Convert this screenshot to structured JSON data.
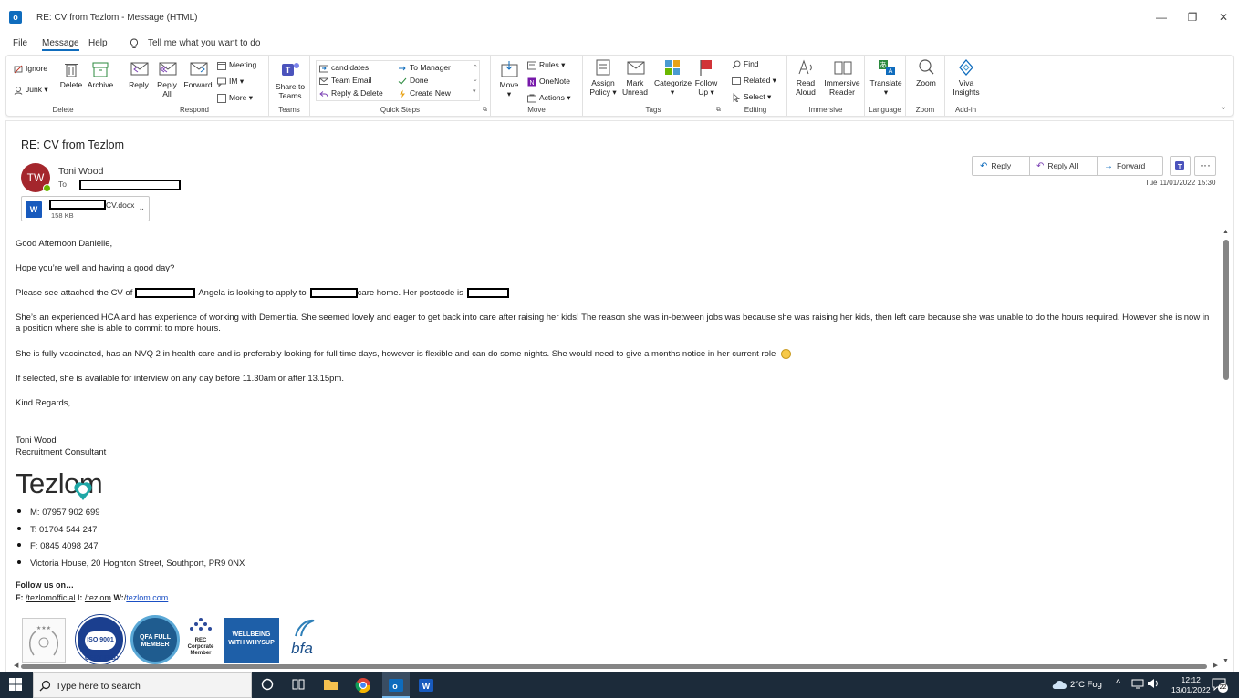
{
  "window": {
    "title": "RE: CV from Tezlom  -  Message (HTML)",
    "minimize": "—",
    "restore": "❐",
    "close": "✕"
  },
  "menu": {
    "tabs": [
      "File",
      "Message",
      "Help"
    ],
    "tell_me": "Tell me what you want to do"
  },
  "ribbon": {
    "delete_group": {
      "label": "Delete",
      "ignore": "Ignore",
      "junk": "Junk",
      "delete": "Delete",
      "archive": "Archive"
    },
    "respond_group": {
      "label": "Respond",
      "reply": "Reply",
      "reply_all": "Reply All",
      "forward": "Forward",
      "meeting": "Meeting",
      "im": "IM",
      "more": "More"
    },
    "teams_group": {
      "label": "Teams",
      "share": "Share to Teams"
    },
    "quicksteps_group": {
      "label": "Quick Steps",
      "candidates": "candidates",
      "team_email": "Team Email",
      "reply_delete": "Reply & Delete",
      "to_manager": "To Manager",
      "done": "Done",
      "create_new": "Create New"
    },
    "move_group": {
      "label": "Move",
      "move": "Move",
      "rules": "Rules",
      "onenote": "OneNote",
      "actions": "Actions"
    },
    "tags_group": {
      "label": "Tags",
      "assign_policy": "Assign Policy",
      "mark_unread": "Mark Unread",
      "categorize": "Categorize",
      "follow_up": "Follow Up"
    },
    "editing_group": {
      "label": "Editing",
      "find": "Find",
      "related": "Related",
      "select": "Select"
    },
    "immersive_group": {
      "label": "Immersive",
      "read_aloud": "Read Aloud",
      "immersive_reader": "Immersive Reader"
    },
    "language_group": {
      "label": "Language",
      "translate": "Translate"
    },
    "zoom_group": {
      "label": "Zoom",
      "zoom": "Zoom"
    },
    "addin_group": {
      "label": "Add-in",
      "viva": "Viva Insights"
    }
  },
  "message": {
    "subject": "RE: CV from Tezlom",
    "avatar_initials": "TW",
    "sender": "Toni Wood",
    "to_label": "To",
    "attachment_name": "CV.docx",
    "attachment_size": "158 KB",
    "attachment_icon": "W",
    "reply": "Reply",
    "reply_all": "Reply All",
    "forward": "Forward",
    "more": "···",
    "datetime": "Tue 11/01/2022 15:30"
  },
  "body": {
    "greeting": "Good Afternoon Danielle,",
    "line1": "Hope you’re well and having a good day?",
    "line2_a": "Please see attached the CV of",
    "line2_b": "Angela is looking to apply to",
    "line2_c": "care home. Her postcode is",
    "para1": "She’s an experienced HCA and has experience of working with Dementia. She seemed lovely and eager to get back into care after raising her kids! The reason she was in-between jobs was because she was raising her kids, then left care because she was unable to do the hours required. However she is now in a position where she is able to commit to more hours.",
    "para2": "She is fully vaccinated, has an NVQ 2 in health care and is preferably looking for full time days, however is flexible and can do some nights. She would need to give a months notice in her current role",
    "para3": "If selected, she is available for interview on any day before 11.30am or after 13.15pm.",
    "closing": "Kind Regards,",
    "sig_name": "Toni Wood",
    "sig_title": "Recruitment Consultant",
    "logo_text": "Tezlom",
    "contacts": [
      "M: 07957 902 699",
      "T: 01704 544 247",
      "F: 0845 4098 247",
      "Victoria House, 20 Hoghton Street, Southport, PR9 0NX"
    ],
    "follow": "Follow us on…",
    "social_f_label": "F:",
    "social_f": "/tezlomofficial",
    "social_i_label": "I:",
    "social_i": "/tezlom",
    "social_w_label": "W:",
    "social_w_slash": "/",
    "social_w": "tezlom.com",
    "badges": [
      "ISO 9001 CERTIFIED",
      "QFA FULL MEMBER",
      "REC Corporate Member",
      "WELLBEING WITH WHYSUP",
      "bfa"
    ]
  },
  "taskbar": {
    "search_placeholder": "Type here to search",
    "weather": "2°C  Fog",
    "time": "12:12",
    "date": "13/01/2022",
    "notifications": "22"
  },
  "colors": {
    "accent": "#0f6cbd",
    "avatar": "#a4262c",
    "taskbar": "#1c2b3a"
  }
}
